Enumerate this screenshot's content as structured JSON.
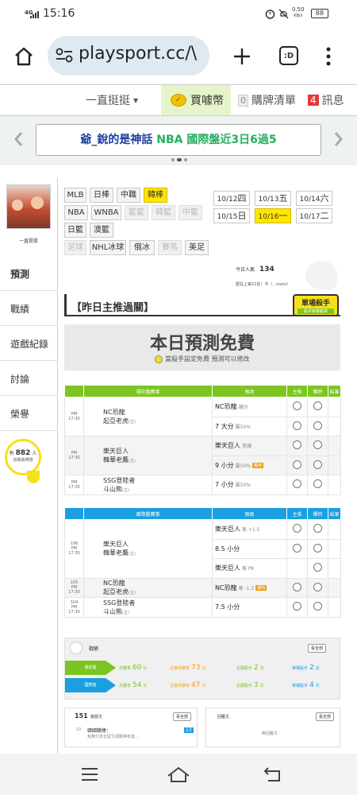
{
  "status_bar": {
    "signal": "4G",
    "time": "15:16",
    "speed": "0.50",
    "speed_unit": "KB/s",
    "battery": "88"
  },
  "browser": {
    "url": "playsport.cc/\\",
    "tab_count": ":D"
  },
  "top_nav": {
    "menu_label": "一直挺挺",
    "coins_label": "買噱幣",
    "cart_count": "0",
    "cart_label": "購牌清單",
    "msg_count": "4",
    "msg_label": "訊息"
  },
  "banner": {
    "user": "爺_銳的是神話",
    "league": "NBA",
    "text": "國際盤近3日6過5",
    "accent": "#27ae60"
  },
  "profile": {
    "name": "一直挺挺"
  },
  "sidebar": {
    "items": [
      {
        "label": "預測",
        "active": true
      },
      {
        "label": "戰績"
      },
      {
        "label": "遊戲紀錄"
      },
      {
        "label": "討論"
      },
      {
        "label": "榮譽"
      }
    ],
    "badge": {
      "prefix": "有",
      "count": "882",
      "suffix": "人",
      "sub": "加我為明燈"
    }
  },
  "leagues": [
    "MLB",
    "日棒",
    "中職",
    "韓棒",
    "NBA",
    "WNBA",
    "籃籃",
    "韓籃",
    "中籃",
    "日籃",
    "澳籃",
    "足球",
    "NHL冰球",
    "俄冰",
    "賽馬",
    "美足"
  ],
  "dates": [
    {
      "date": "10/12",
      "dow": "四"
    },
    {
      "date": "10/13",
      "dow": "五"
    },
    {
      "date": "10/14",
      "dow": "六"
    },
    {
      "date": "10/15",
      "dow": "日"
    },
    {
      "date": "10/16",
      "dow": "一",
      "selected": true
    },
    {
      "date": "10/17",
      "dow": "二"
    }
  ],
  "stats": {
    "today_label": "今日人氣",
    "today_value": "134",
    "rank_text": "歷站上第22名！今（...more）"
  },
  "section": {
    "title": "【昨日主推過關】",
    "badge": "單場殺手",
    "badge_sub": "殺手榮譽勳章"
  },
  "free_banner": {
    "title": "本日預測免費",
    "subtitle": "當殺手設定免費 預測可以修改"
  },
  "table1": {
    "headers": [
      "運彩盤賽事",
      "預測",
      "主推",
      "獨特",
      "結果"
    ],
    "color": "#7cc520",
    "games": [
      {
        "time": "PM 17:30",
        "team_a": "NC恐龍",
        "team_b": "起亞老虎",
        "home_mark": "(主)",
        "picks": [
          {
            "pick": "NC恐龍",
            "sub": "讓分",
            "odds": "2分贏50%"
          },
          {
            "pick": "7 大分",
            "sub": "贏50%",
            "odds": ""
          }
        ]
      },
      {
        "time": "PM 17:30",
        "team_a": "樂天巨人",
        "team_b": "韓華老鷹",
        "home_mark": "(主)",
        "picks": [
          {
            "pick": "樂天巨人",
            "sub": "受讓",
            "odds": "1分贏50%"
          },
          {
            "pick": "9 小分",
            "sub": "贏50%",
            "odds": "",
            "tag": "獨特"
          }
        ]
      },
      {
        "time": "PM 17:30",
        "team_a": "SSG登陸者",
        "team_b": "斗山熊",
        "home_mark": "(主)",
        "picks": [
          {
            "pick": "7 小分",
            "sub": "贏50%",
            "odds": "1分贏50%"
          }
        ]
      }
    ]
  },
  "table2": {
    "headers": [
      "國際盤賽事",
      "預測",
      "主推",
      "獨特",
      "結果"
    ],
    "color": "#1a9fe0",
    "games": [
      {
        "num": "106",
        "time": "PM 17:30",
        "team_a": "樂天巨人",
        "team_b": "韓華老鷹",
        "home_mark": "(主)",
        "picks": [
          {
            "pick": "樂天巨人",
            "sub": "客 +1.5"
          },
          {
            "pick": "8.5 小分",
            "sub": ""
          },
          {
            "pick": "樂天巨人",
            "sub": "客 PK"
          }
        ]
      },
      {
        "num": "105",
        "time": "PM 17:30",
        "team_a": "NC恐龍",
        "team_b": "起亞老虎",
        "home_mark": "(主)",
        "picks": [
          {
            "pick": "NC恐龍",
            "sub": "客 -1.5",
            "tag": "獨特"
          }
        ]
      },
      {
        "num": "104",
        "time": "PM 17:30",
        "team_a": "SSG登陸者",
        "team_b": "斗山熊",
        "home_mark": "(主)",
        "picks": [
          {
            "pick": "7.5 小分",
            "sub": ""
          }
        ]
      }
    ]
  },
  "record": {
    "title": "戰績",
    "more": "看全部",
    "rows": [
      {
        "label": "運彩盤",
        "color": "#7cc520",
        "m_label": "月勝率",
        "m_val": "60",
        "z_label": "主推月勝率",
        "z_val": "73",
        "s_label": "近期殺手",
        "s_val": "2",
        "k_label": "單場殺手",
        "k_val": "2",
        "unit": "次"
      },
      {
        "label": "國際盤",
        "color": "#1a9fe0",
        "m_label": "月勝率",
        "m_val": "54",
        "z_label": "主推月勝率",
        "z_val": "47",
        "s_label": "近期殺手",
        "s_val": "3",
        "k_label": "單場殺手",
        "k_val": "4",
        "unit": "次"
      }
    ]
  },
  "posts": {
    "count": "151",
    "label": "篇發文",
    "more": "看全部",
    "item_num": "10",
    "item_title": "韓國職棒：",
    "item_text": "免費分享也留文請關神有批...",
    "item_badge": "13",
    "reply_label": "回覆文",
    "reply_empty": "無回覆文"
  }
}
